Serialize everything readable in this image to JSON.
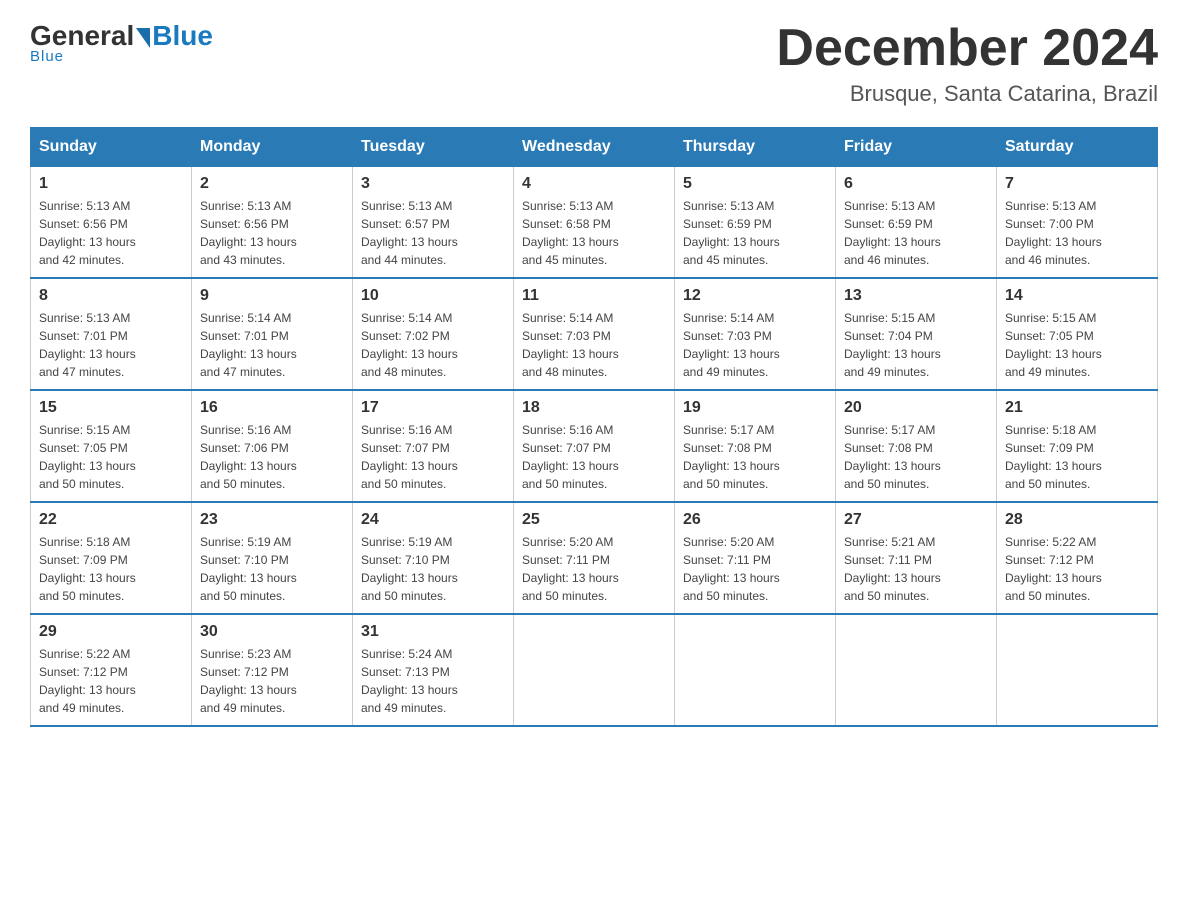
{
  "header": {
    "logo": {
      "general": "General",
      "blue": "Blue"
    },
    "title": "December 2024",
    "location": "Brusque, Santa Catarina, Brazil"
  },
  "columns": [
    "Sunday",
    "Monday",
    "Tuesday",
    "Wednesday",
    "Thursday",
    "Friday",
    "Saturday"
  ],
  "weeks": [
    [
      {
        "day": "1",
        "sunrise": "5:13 AM",
        "sunset": "6:56 PM",
        "daylight": "13 hours and 42 minutes."
      },
      {
        "day": "2",
        "sunrise": "5:13 AM",
        "sunset": "6:56 PM",
        "daylight": "13 hours and 43 minutes."
      },
      {
        "day": "3",
        "sunrise": "5:13 AM",
        "sunset": "6:57 PM",
        "daylight": "13 hours and 44 minutes."
      },
      {
        "day": "4",
        "sunrise": "5:13 AM",
        "sunset": "6:58 PM",
        "daylight": "13 hours and 45 minutes."
      },
      {
        "day": "5",
        "sunrise": "5:13 AM",
        "sunset": "6:59 PM",
        "daylight": "13 hours and 45 minutes."
      },
      {
        "day": "6",
        "sunrise": "5:13 AM",
        "sunset": "6:59 PM",
        "daylight": "13 hours and 46 minutes."
      },
      {
        "day": "7",
        "sunrise": "5:13 AM",
        "sunset": "7:00 PM",
        "daylight": "13 hours and 46 minutes."
      }
    ],
    [
      {
        "day": "8",
        "sunrise": "5:13 AM",
        "sunset": "7:01 PM",
        "daylight": "13 hours and 47 minutes."
      },
      {
        "day": "9",
        "sunrise": "5:14 AM",
        "sunset": "7:01 PM",
        "daylight": "13 hours and 47 minutes."
      },
      {
        "day": "10",
        "sunrise": "5:14 AM",
        "sunset": "7:02 PM",
        "daylight": "13 hours and 48 minutes."
      },
      {
        "day": "11",
        "sunrise": "5:14 AM",
        "sunset": "7:03 PM",
        "daylight": "13 hours and 48 minutes."
      },
      {
        "day": "12",
        "sunrise": "5:14 AM",
        "sunset": "7:03 PM",
        "daylight": "13 hours and 49 minutes."
      },
      {
        "day": "13",
        "sunrise": "5:15 AM",
        "sunset": "7:04 PM",
        "daylight": "13 hours and 49 minutes."
      },
      {
        "day": "14",
        "sunrise": "5:15 AM",
        "sunset": "7:05 PM",
        "daylight": "13 hours and 49 minutes."
      }
    ],
    [
      {
        "day": "15",
        "sunrise": "5:15 AM",
        "sunset": "7:05 PM",
        "daylight": "13 hours and 50 minutes."
      },
      {
        "day": "16",
        "sunrise": "5:16 AM",
        "sunset": "7:06 PM",
        "daylight": "13 hours and 50 minutes."
      },
      {
        "day": "17",
        "sunrise": "5:16 AM",
        "sunset": "7:07 PM",
        "daylight": "13 hours and 50 minutes."
      },
      {
        "day": "18",
        "sunrise": "5:16 AM",
        "sunset": "7:07 PM",
        "daylight": "13 hours and 50 minutes."
      },
      {
        "day": "19",
        "sunrise": "5:17 AM",
        "sunset": "7:08 PM",
        "daylight": "13 hours and 50 minutes."
      },
      {
        "day": "20",
        "sunrise": "5:17 AM",
        "sunset": "7:08 PM",
        "daylight": "13 hours and 50 minutes."
      },
      {
        "day": "21",
        "sunrise": "5:18 AM",
        "sunset": "7:09 PM",
        "daylight": "13 hours and 50 minutes."
      }
    ],
    [
      {
        "day": "22",
        "sunrise": "5:18 AM",
        "sunset": "7:09 PM",
        "daylight": "13 hours and 50 minutes."
      },
      {
        "day": "23",
        "sunrise": "5:19 AM",
        "sunset": "7:10 PM",
        "daylight": "13 hours and 50 minutes."
      },
      {
        "day": "24",
        "sunrise": "5:19 AM",
        "sunset": "7:10 PM",
        "daylight": "13 hours and 50 minutes."
      },
      {
        "day": "25",
        "sunrise": "5:20 AM",
        "sunset": "7:11 PM",
        "daylight": "13 hours and 50 minutes."
      },
      {
        "day": "26",
        "sunrise": "5:20 AM",
        "sunset": "7:11 PM",
        "daylight": "13 hours and 50 minutes."
      },
      {
        "day": "27",
        "sunrise": "5:21 AM",
        "sunset": "7:11 PM",
        "daylight": "13 hours and 50 minutes."
      },
      {
        "day": "28",
        "sunrise": "5:22 AM",
        "sunset": "7:12 PM",
        "daylight": "13 hours and 50 minutes."
      }
    ],
    [
      {
        "day": "29",
        "sunrise": "5:22 AM",
        "sunset": "7:12 PM",
        "daylight": "13 hours and 49 minutes."
      },
      {
        "day": "30",
        "sunrise": "5:23 AM",
        "sunset": "7:12 PM",
        "daylight": "13 hours and 49 minutes."
      },
      {
        "day": "31",
        "sunrise": "5:24 AM",
        "sunset": "7:13 PM",
        "daylight": "13 hours and 49 minutes."
      },
      null,
      null,
      null,
      null
    ]
  ],
  "labels": {
    "sunrise_prefix": "Sunrise: ",
    "sunset_prefix": "Sunset: ",
    "daylight_prefix": "Daylight: "
  }
}
